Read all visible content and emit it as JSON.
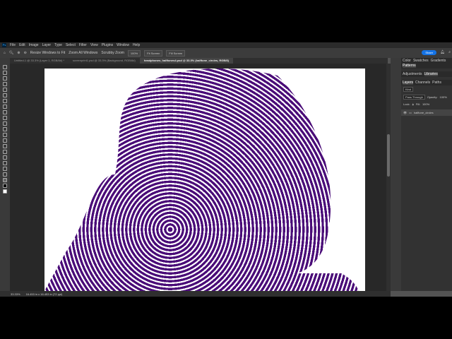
{
  "menu": [
    "File",
    "Edit",
    "Image",
    "Layer",
    "Type",
    "Select",
    "Filter",
    "View",
    "Plugins",
    "Window",
    "Help"
  ],
  "options": {
    "resize": "Resize Windows to Fit",
    "zoom_all": "Zoom All Windows",
    "scrubby": "Scrubby Zoom",
    "zoom_pct": "100%",
    "fit": "Fit Screen",
    "fill": "Fill Screen",
    "share": "Share"
  },
  "tabs": [
    "Untitled-1 @ 33.3% (Layer 1, RGB/8#) *",
    "screenprint1.psd @ 33.3% (Background, RGB/8#)",
    "headphones_halftones4.psd @ 33.3% (halftone_circles, RGB/8)"
  ],
  "panels": {
    "top_tabs": [
      "Color",
      "Swatches",
      "Gradients",
      "Patterns"
    ],
    "mid_tabs": [
      "Adjustments",
      "Libraries"
    ],
    "layer_tabs": [
      "Layers",
      "Channels",
      "Paths"
    ],
    "kind": "Kind",
    "blend": "Pass Through",
    "opacity_label": "Opacity:",
    "opacity": "100%",
    "lock_label": "Lock:",
    "fill_label": "Fill:",
    "fill": "100%",
    "layer_name": "halftone_circles"
  },
  "status": {
    "zoom": "33.33%",
    "doc": "16.453 in x 16.453 in (72 ppi)"
  },
  "colors": {
    "ink": "#4a0c78",
    "accent": "#1473e6"
  }
}
